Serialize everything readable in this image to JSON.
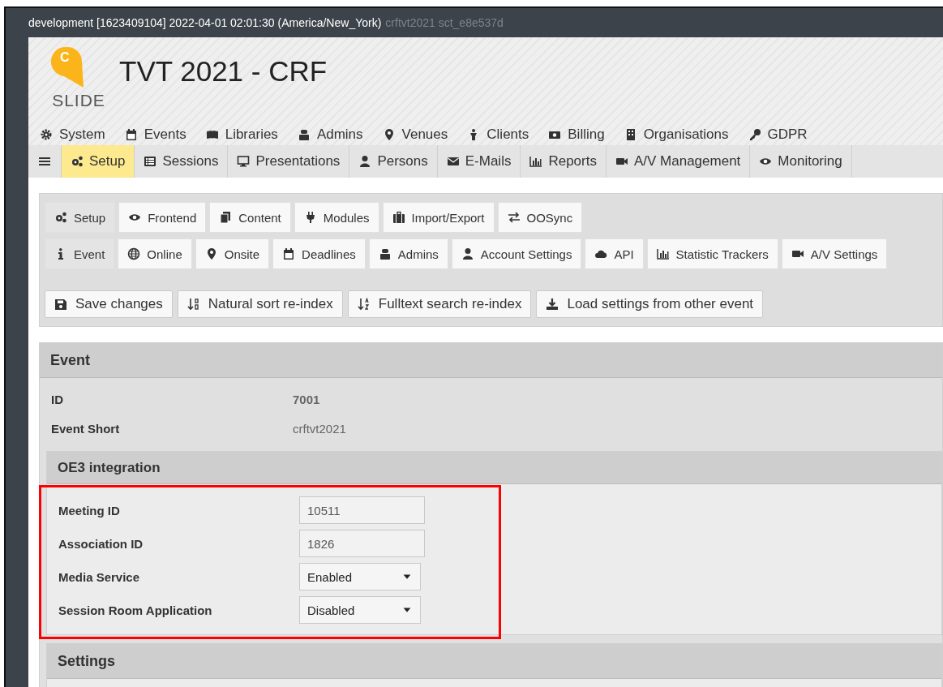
{
  "top_bar": {
    "environment": "development [1623409104] 2022-04-01 02:01:30 (America/New_York)",
    "context": "crftvt2021 sct_e8e537d"
  },
  "logo": {
    "letter": "C",
    "word": "SLIDE"
  },
  "title": "TVT 2021 - CRF",
  "main_menu": [
    {
      "label": "System"
    },
    {
      "label": "Events"
    },
    {
      "label": "Libraries"
    },
    {
      "label": "Admins"
    },
    {
      "label": "Venues"
    },
    {
      "label": "Clients"
    },
    {
      "label": "Billing"
    },
    {
      "label": "Organisations"
    },
    {
      "label": "GDPR"
    }
  ],
  "toolbar": [
    {
      "label": "Setup",
      "selected": true
    },
    {
      "label": "Sessions",
      "selected": false
    },
    {
      "label": "Presentations",
      "selected": false
    },
    {
      "label": "Persons",
      "selected": false
    },
    {
      "label": "E-Mails",
      "selected": false
    },
    {
      "label": "Reports",
      "selected": false
    },
    {
      "label": "A/V Management",
      "selected": false
    },
    {
      "label": "Monitoring",
      "selected": false
    }
  ],
  "tabs": [
    {
      "label": "Setup",
      "selected": true
    },
    {
      "label": "Frontend",
      "selected": false
    },
    {
      "label": "Content",
      "selected": false
    },
    {
      "label": "Modules",
      "selected": false
    },
    {
      "label": "Import/Export",
      "selected": false
    },
    {
      "label": "OOSync",
      "selected": false
    }
  ],
  "subtabs": [
    {
      "label": "Event",
      "selected": true
    },
    {
      "label": "Online",
      "selected": false
    },
    {
      "label": "Onsite",
      "selected": false
    },
    {
      "label": "Deadlines",
      "selected": false
    },
    {
      "label": "Admins",
      "selected": false
    },
    {
      "label": "Account Settings",
      "selected": false
    },
    {
      "label": "API",
      "selected": false
    },
    {
      "label": "Statistic Trackers",
      "selected": false
    },
    {
      "label": "A/V Settings",
      "selected": false
    }
  ],
  "actions": [
    "Save changes",
    "Natural sort re-index",
    "Fulltext search re-index",
    "Load settings from other event"
  ],
  "event": {
    "heading": "Event",
    "fields": [
      {
        "label": "ID",
        "value": "7001",
        "bold": true
      },
      {
        "label": "Event Short",
        "value": "crftvt2021",
        "bold": false
      }
    ],
    "integration": {
      "heading": "OE3 integration",
      "highlighted": true,
      "fields": [
        {
          "label": "Meeting ID",
          "kind": "text",
          "value": "10511"
        },
        {
          "label": "Association ID",
          "kind": "text",
          "value": "1826"
        },
        {
          "label": "Media Service",
          "kind": "select",
          "value": "Enabled"
        },
        {
          "label": "Session Room Application",
          "kind": "select",
          "value": "Disabled"
        }
      ]
    },
    "settings": {
      "heading": "Settings"
    }
  }
}
